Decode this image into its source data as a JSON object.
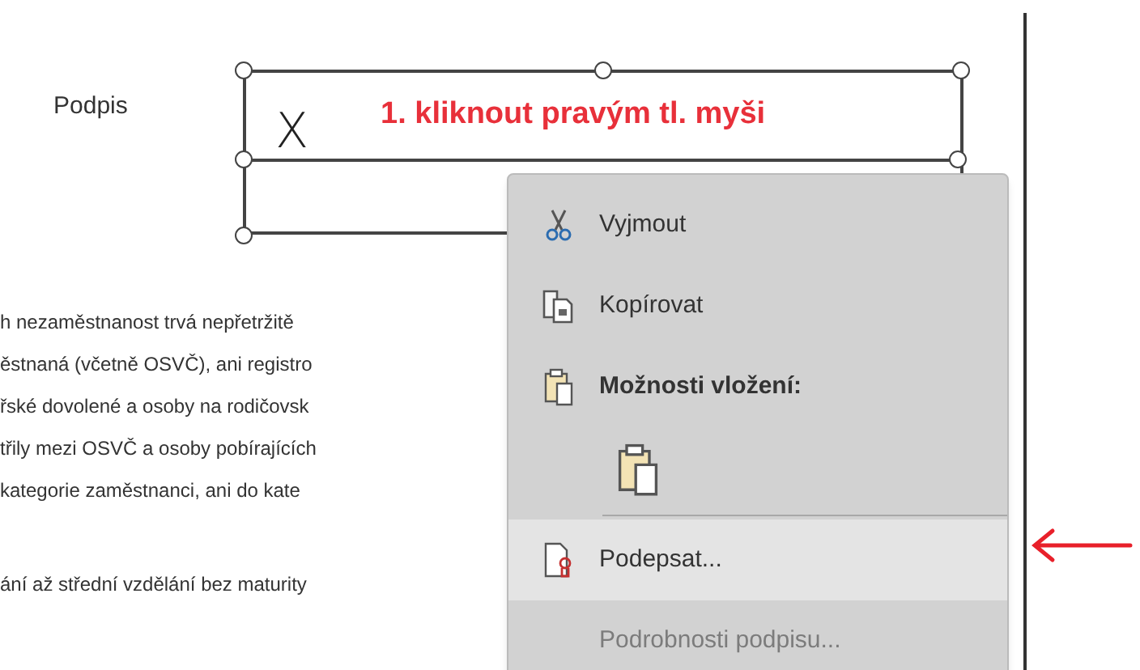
{
  "document": {
    "signature_label": "Podpis",
    "signature_note": "1. kliknout pravým tl. myši",
    "signature_mark": "X",
    "paragraph_lines": [
      "h nezaměstnanost trvá nepřetržitě",
      "ěstnaná (včetně OSVČ), ani registro",
      "řské dovolené a osoby na rodičovsk",
      "třily mezi OSVČ a osoby pobírajících",
      "kategorie zaměstnanci, ani do kate"
    ],
    "lower_lines": [
      "ání až střední vzdělání bez maturity"
    ]
  },
  "context_menu": {
    "items": [
      {
        "kind": "command",
        "label": "Vyjmout",
        "disabled": false,
        "selected": false
      },
      {
        "kind": "command",
        "label": "Kopírovat",
        "disabled": false,
        "selected": false
      },
      {
        "kind": "header",
        "label": "Možnosti vložení:"
      },
      {
        "kind": "paste-option"
      },
      {
        "kind": "separator"
      },
      {
        "kind": "command",
        "label": "Podepsat...",
        "disabled": false,
        "selected": true
      },
      {
        "kind": "command",
        "label": "Podrobnosti podpisu...",
        "disabled": true,
        "selected": false
      }
    ]
  }
}
